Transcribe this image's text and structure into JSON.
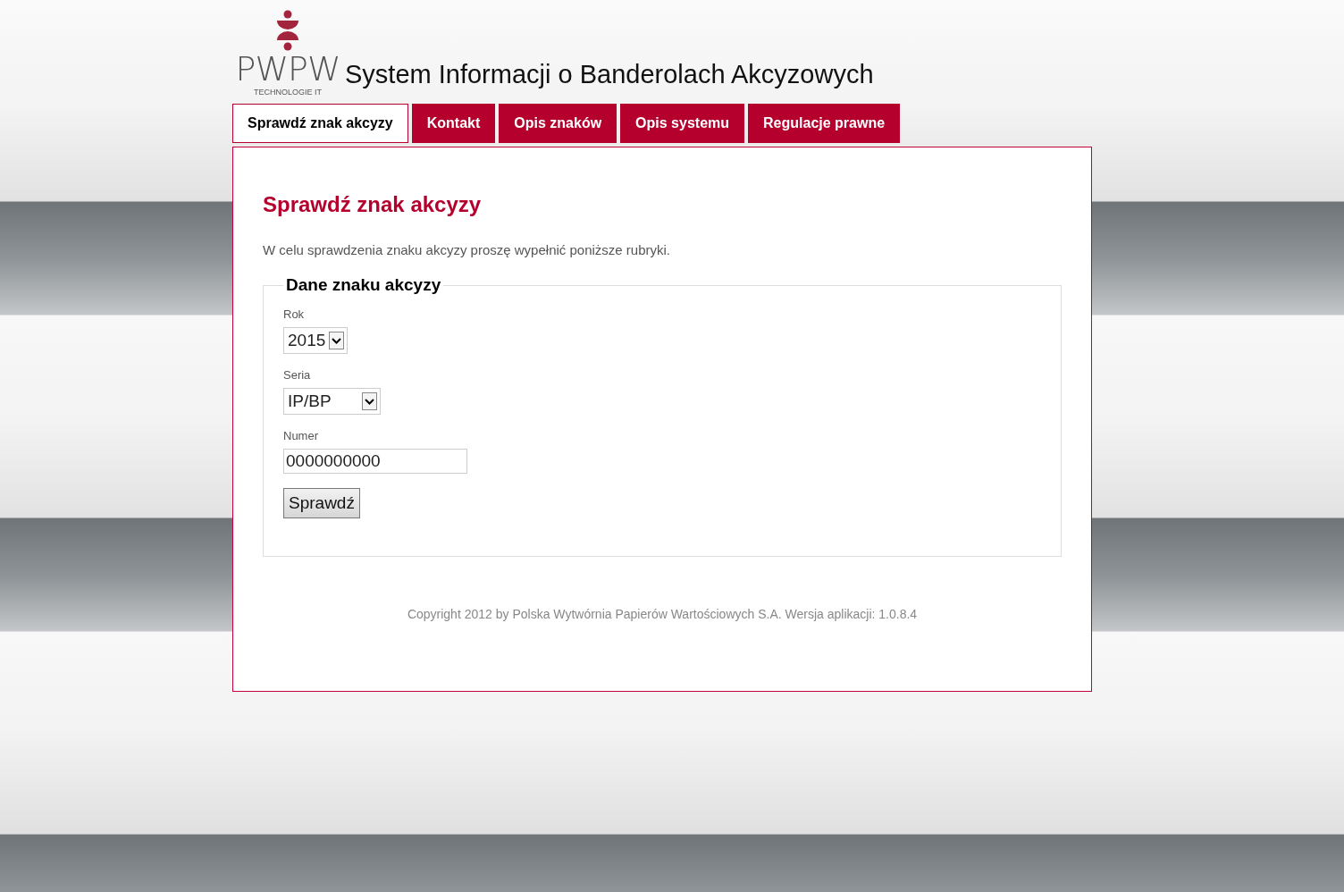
{
  "logo": {
    "name": "PWPW",
    "tagline": "TECHNOLOGIE IT"
  },
  "site_title": "System Informacji o Banderolach Akcyzowych",
  "tabs": [
    {
      "label": "Sprawdź znak akcyzy",
      "selected": true
    },
    {
      "label": "Kontakt",
      "selected": false
    },
    {
      "label": "Opis znaków",
      "selected": false
    },
    {
      "label": "Opis systemu",
      "selected": false
    },
    {
      "label": "Regulacje prawne",
      "selected": false
    }
  ],
  "heading": "Sprawdź znak akcyzy",
  "intro": "W celu sprawdzenia znaku akcyzy proszę wypełnić poniższe rubryki.",
  "form": {
    "legend": "Dane znaku akcyzy",
    "fields": [
      {
        "kind": "select",
        "label": "Rok",
        "value": "2015"
      },
      {
        "kind": "select",
        "label": "Seria",
        "value": "IP/BP"
      },
      {
        "kind": "text",
        "label": "Numer",
        "value": "0000000000"
      }
    ],
    "submit": "Sprawdź"
  },
  "footer": "Copyright 2012 by Polska Wytwórnia Papierów Wartościowych S.A. Wersja aplikacji: 1.0.8.4"
}
